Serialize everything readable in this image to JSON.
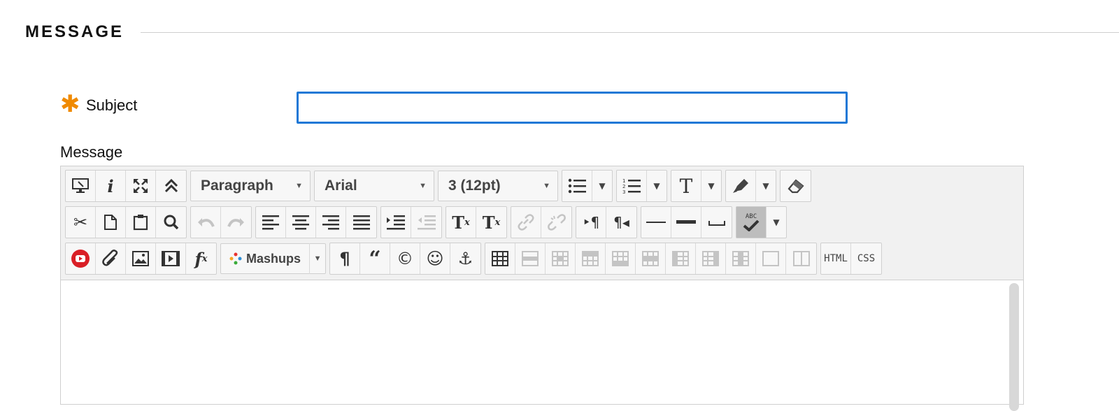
{
  "section": {
    "title": "MESSAGE"
  },
  "form": {
    "subject_label": "Subject",
    "required_mark": "✱",
    "subject_value": "",
    "message_label": "Message"
  },
  "editor": {
    "block_format": "Paragraph",
    "font_family": "Arial",
    "font_size": "3 (12pt)",
    "mashups_label": "Mashups",
    "html_label": "HTML",
    "css_label": "CSS",
    "superscript_label": "T",
    "superscript_x": "x",
    "subscript_label": "T",
    "subscript_x": "x",
    "fx_label": "f",
    "fx_sub": "x",
    "spellcheck_label": "ABC"
  },
  "colors": {
    "accent": "#1d78d6",
    "required": "#f08a00",
    "toolbar_bg": "#f1f1f1"
  }
}
